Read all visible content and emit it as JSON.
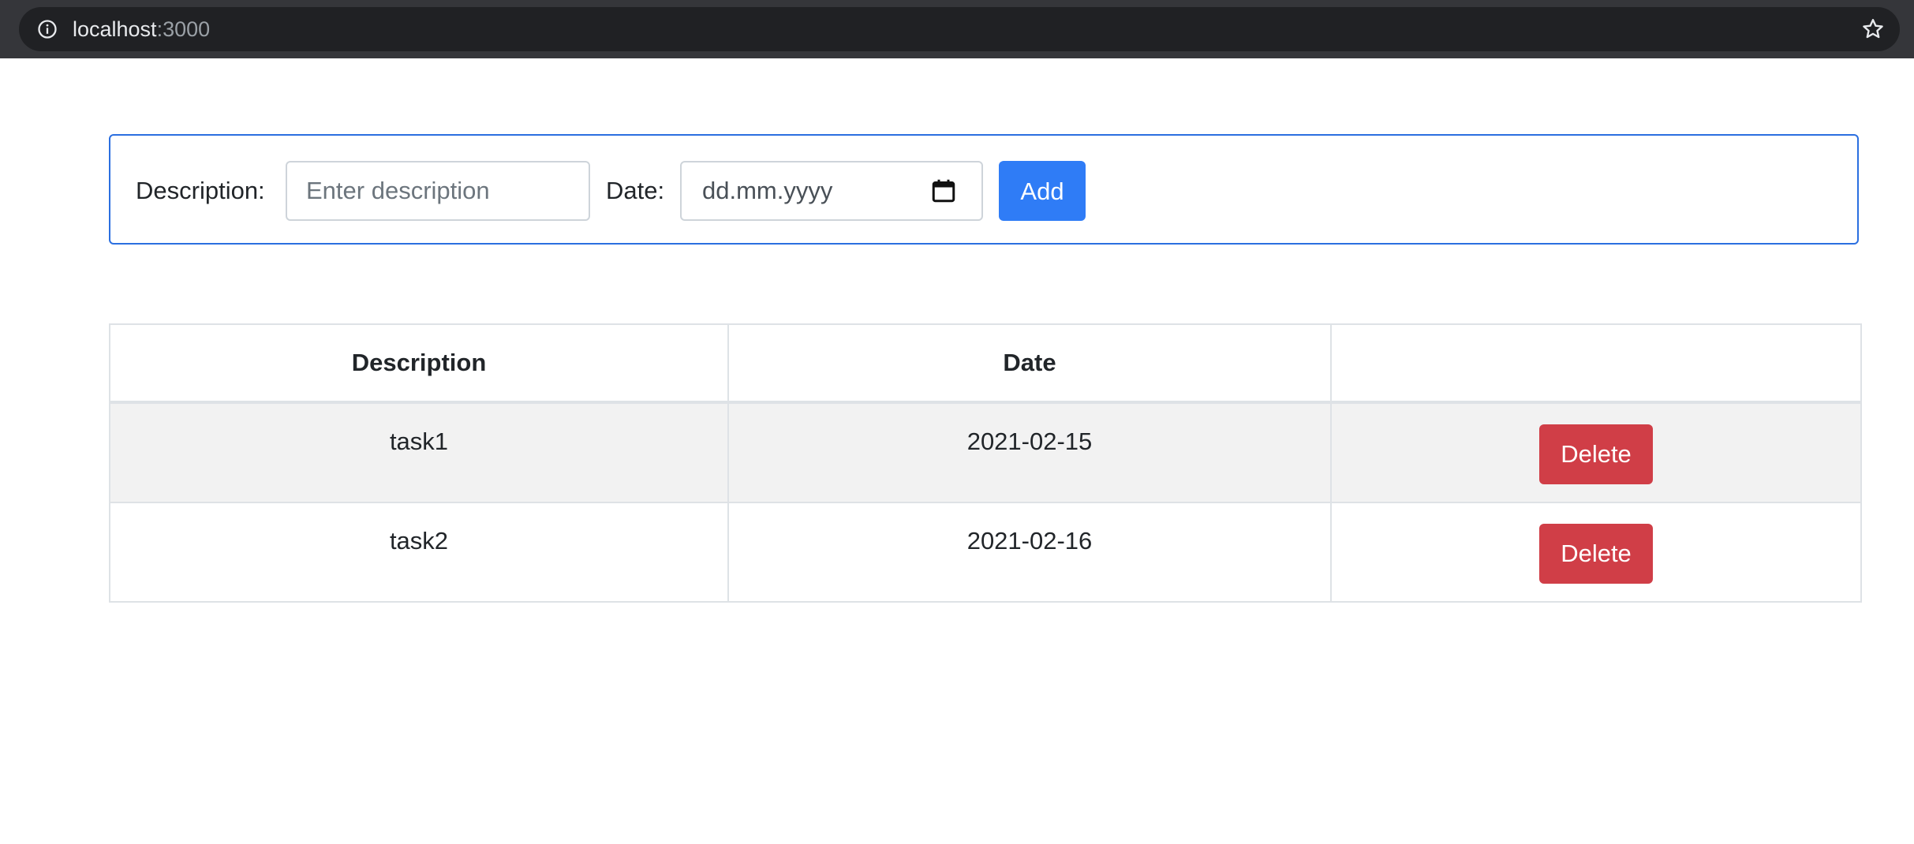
{
  "browser": {
    "host": "localhost",
    "port": ":3000",
    "icons": {
      "info": "info-icon",
      "bookmark": "star-icon"
    }
  },
  "form": {
    "description_label": "Description:",
    "description_placeholder": "Enter description",
    "date_label": "Date:",
    "date_placeholder": "dd.mm.yyyy",
    "add_label": "Add",
    "accent_color": "#2f7cf6",
    "icons": {
      "calendar": "calendar-icon"
    }
  },
  "table": {
    "headers": [
      "Description",
      "Date",
      ""
    ],
    "rows": [
      {
        "description": "task1",
        "date": "2021-02-15",
        "action": "Delete"
      },
      {
        "description": "task2",
        "date": "2021-02-16",
        "action": "Delete"
      }
    ],
    "delete_color": "#d03e47"
  }
}
